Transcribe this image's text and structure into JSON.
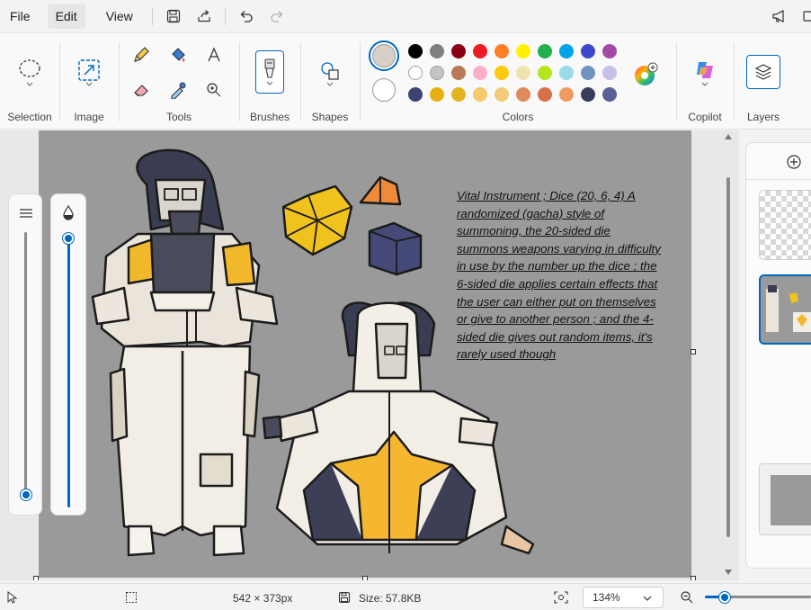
{
  "menu": {
    "file": "File",
    "edit": "Edit",
    "view": "View"
  },
  "ribbon": {
    "groups": {
      "selection": "Selection",
      "image": "Image",
      "tools": "Tools",
      "brushes": "Brushes",
      "shapes": "Shapes",
      "colors": "Colors",
      "copilot": "Copilot",
      "layers": "Layers"
    },
    "palette_row1": [
      "#000000",
      "#7f7f7f",
      "#880015",
      "#ed1c24",
      "#ff7f27",
      "#fff200",
      "#22b14c",
      "#00a2e8",
      "#3f48cc",
      "#a349a4"
    ],
    "palette_row2": [
      "#ffffff",
      "#c3c3c3",
      "#b97a57",
      "#ffaec9",
      "#ffc90e",
      "#efe4b0",
      "#b5e61d",
      "#99d9ea",
      "#7092be",
      "#c8bfe7"
    ],
    "palette_row3": [
      "#3d4370",
      "#e6b012",
      "#e3b320",
      "#f6c96a",
      "#f3cb79",
      "#e08a5e",
      "#d9704a",
      "#f09a62",
      "#3a3d5a",
      "#5a6096"
    ],
    "primary_color": "#d8cfc6",
    "secondary_color": "#ffffff"
  },
  "canvas": {
    "background": "#9a9a9a",
    "annotation": "Vital Instrument ; Dice (20, 6, 4) A randomized (gacha) style of summoning, the 20-sided die summons weapons varying in difficulty in use by the number up the dice ; the 6-sided die applies certain effects that the user can either put on themselves or give to another person ; and the 4-sided die gives out random items, it's rarely used though"
  },
  "status": {
    "dimensions": "542 × 373px",
    "size": "Size: 57.8KB",
    "zoom": "134%"
  },
  "icons": {
    "save": "save-icon",
    "share": "share-icon",
    "undo": "undo-icon",
    "redo": "redo-icon"
  }
}
